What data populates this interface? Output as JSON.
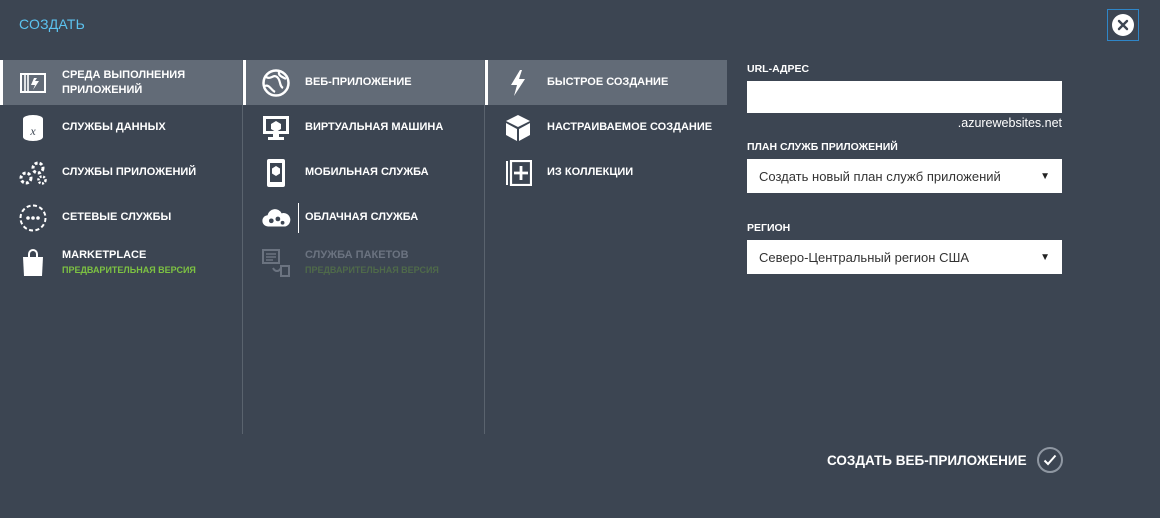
{
  "dialog": {
    "title": "СОЗДАТЬ",
    "close_icon": "close-icon"
  },
  "col1": {
    "items": [
      {
        "label": "СРЕДА ВЫПОЛНЕНИЯ ПРИЛОЖЕНИЙ",
        "icon": "compute-icon",
        "selected": true
      },
      {
        "label": "СЛУЖБЫ ДАННЫХ",
        "icon": "data-services-icon"
      },
      {
        "label": "СЛУЖБЫ ПРИЛОЖЕНИЙ",
        "icon": "app-services-icon"
      },
      {
        "label": "СЕТЕВЫЕ СЛУЖБЫ",
        "icon": "network-services-icon"
      },
      {
        "label": "MARKETPLACE",
        "sub": "ПРЕДВАРИТЕЛЬНАЯ ВЕРСИЯ",
        "icon": "marketplace-bag-icon"
      }
    ]
  },
  "col2": {
    "items": [
      {
        "label": "ВЕБ-ПРИЛОЖЕНИЕ",
        "icon": "web-app-globe-icon",
        "selected": true
      },
      {
        "label": "ВИРТУАЛЬНАЯ МАШИНА",
        "icon": "virtual-machine-icon"
      },
      {
        "label": "МОБИЛЬНАЯ СЛУЖБА",
        "icon": "mobile-service-icon"
      },
      {
        "label": "ОБЛАЧНАЯ СЛУЖБА",
        "icon": "cloud-service-icon"
      },
      {
        "label": "СЛУЖБА ПАКЕТОВ",
        "sub": "ПРЕДВАРИТЕЛЬНАЯ ВЕРСИЯ",
        "icon": "batch-service-icon",
        "disabled": true
      }
    ]
  },
  "col3": {
    "items": [
      {
        "label": "БЫСТРОЕ СОЗДАНИЕ",
        "icon": "lightning-icon",
        "selected": true
      },
      {
        "label": "НАСТРАИВАЕМОЕ СОЗДАНИЕ",
        "icon": "custom-create-box-icon"
      },
      {
        "label": "ИЗ КОЛЛЕКЦИИ",
        "icon": "gallery-plus-icon"
      }
    ]
  },
  "form": {
    "url_label": "URL-АДРЕС",
    "url_value": "",
    "url_suffix": ".azurewebsites.net",
    "plan_label": "ПЛАН СЛУЖБ ПРИЛОЖЕНИЙ",
    "plan_value": "Создать новый план служб приложений",
    "region_label": "РЕГИОН",
    "region_value": "Северо-Центральный регион США",
    "dropdown_icon": "dropdown-arrow-icon"
  },
  "submit": {
    "label": "СОЗДАТЬ ВЕБ-ПРИЛОЖЕНИЕ",
    "icon": "checkmark-icon"
  },
  "colors": {
    "background": "#3c4552",
    "title": "#5cc3f0",
    "selected_bg": "#626b77",
    "preview_badge": "#7dc242"
  }
}
